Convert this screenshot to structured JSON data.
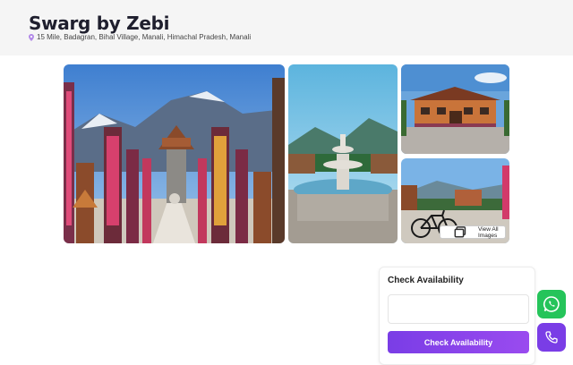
{
  "property": {
    "name": "Swarg by Zebi",
    "address": "15 Mile, Badagran, Bihal Village, Manali, Himachal Pradesh, Manali"
  },
  "gallery": {
    "view_all_label": "View All Images",
    "images": [
      "temple-courtyard",
      "fountain",
      "resort-building",
      "bicycle-lawn"
    ]
  },
  "availability": {
    "heading": "Check Availability",
    "input_value": "",
    "button_label": "Check Availability"
  },
  "colors": {
    "accent": "#7a3de6",
    "whatsapp": "#25c45a"
  },
  "icons": [
    "location-pin-icon",
    "gallery-icon",
    "whatsapp-icon",
    "phone-icon"
  ]
}
